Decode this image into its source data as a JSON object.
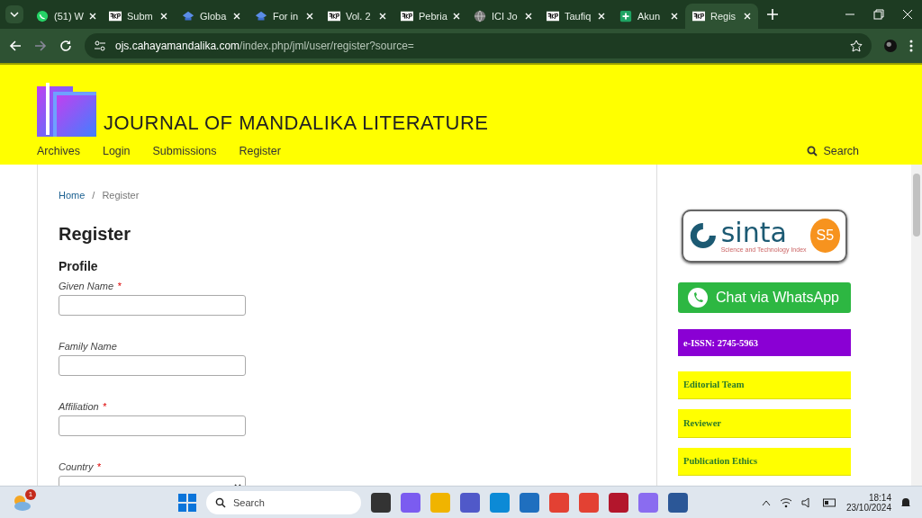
{
  "browser": {
    "tabs": [
      {
        "title": "(51) W",
        "kind": "chat",
        "selected": false
      },
      {
        "title": "Subm",
        "kind": "pkp",
        "selected": false
      },
      {
        "title": "Globa",
        "kind": "cap",
        "selected": false
      },
      {
        "title": "For in",
        "kind": "cap",
        "selected": false
      },
      {
        "title": "Vol. 2",
        "kind": "pkp",
        "selected": false
      },
      {
        "title": "Pebria",
        "kind": "pkp",
        "selected": false
      },
      {
        "title": "ICI Jo",
        "kind": "globe",
        "selected": false
      },
      {
        "title": "Taufiq",
        "kind": "pkp",
        "selected": false
      },
      {
        "title": "Akun",
        "kind": "plus",
        "selected": false
      },
      {
        "title": "Regis",
        "kind": "pkp",
        "selected": true
      }
    ],
    "address": {
      "domain": "ojs.cahayamandalika.com",
      "path": "/index.php/jml/user/register?source="
    }
  },
  "site": {
    "title": "JOURNAL OF MANDALIKA LITERATURE",
    "nav": [
      "Archives",
      "Login",
      "Submissions",
      "Register"
    ],
    "search": "Search"
  },
  "breadcrumb": {
    "home": "Home",
    "separator": "/",
    "current": "Register"
  },
  "page_title": "Register",
  "section_title": "Profile",
  "fields": [
    {
      "label": "Given Name",
      "required": true,
      "kind": "text"
    },
    {
      "label": "Family Name",
      "required": false,
      "kind": "text"
    },
    {
      "label": "Affiliation",
      "required": true,
      "kind": "text"
    },
    {
      "label": "Country",
      "required": true,
      "kind": "select"
    }
  ],
  "required_mark": "*",
  "sidebar": {
    "sinta": {
      "word": "sinta",
      "tagline": "Science and Technology Index",
      "grade": "S5"
    },
    "whatsapp": "Chat via WhatsApp",
    "issn": "e-ISSN: 2745-5963",
    "links": [
      "Editorial Team",
      "Reviewer",
      "Publication Ethics"
    ]
  },
  "taskbar": {
    "notification_count": "1",
    "search": "Search",
    "time": "18:14",
    "date": "23/10/2024"
  }
}
